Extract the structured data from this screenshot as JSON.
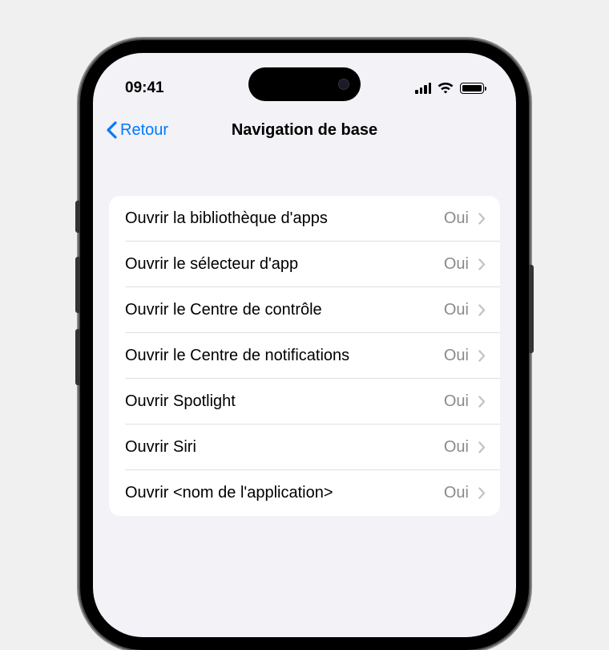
{
  "status_bar": {
    "time": "09:41"
  },
  "nav": {
    "back_label": "Retour",
    "title": "Navigation de base"
  },
  "list": {
    "items": [
      {
        "label": "Ouvrir la bibliothèque d'apps",
        "value": "Oui"
      },
      {
        "label": "Ouvrir le sélecteur d'app",
        "value": "Oui"
      },
      {
        "label": "Ouvrir le Centre de contrôle",
        "value": "Oui"
      },
      {
        "label": "Ouvrir le Centre de notifications",
        "value": "Oui"
      },
      {
        "label": "Ouvrir Spotlight",
        "value": "Oui"
      },
      {
        "label": "Ouvrir Siri",
        "value": "Oui"
      },
      {
        "label": "Ouvrir <nom de l'application>",
        "value": "Oui"
      }
    ]
  }
}
